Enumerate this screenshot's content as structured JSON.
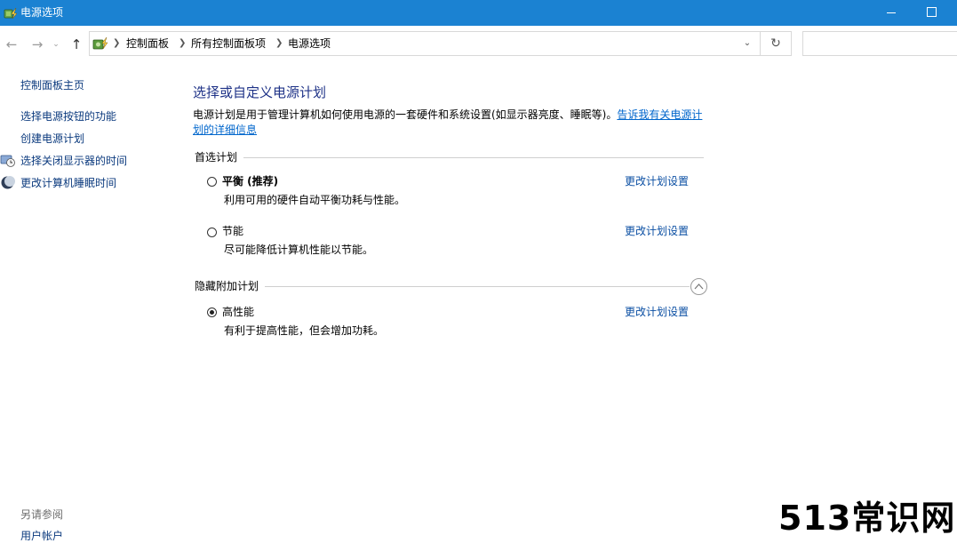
{
  "window": {
    "title": "电源选项",
    "icons": {
      "app": "power-options-icon",
      "minimize": "minimize-icon",
      "maximize": "maximize-icon"
    },
    "accent": "#1b82d2"
  },
  "nav": {
    "back_icon": "←",
    "forward_icon": "→",
    "recent_icon": "⌄",
    "up_icon": "↑",
    "breadcrumb": [
      "控制面板",
      "所有控制面板项",
      "电源选项"
    ],
    "dropdown_icon": "⌄",
    "refresh_icon": "↻",
    "search_placeholder": ""
  },
  "sidebar": {
    "home": "控制面板主页",
    "links": [
      {
        "label": "选择电源按钮的功能",
        "icon": null
      },
      {
        "label": "创建电源计划",
        "icon": null
      },
      {
        "label": "选择关闭显示器的时间",
        "icon": "monitor-clock-icon"
      },
      {
        "label": "更改计算机睡眠时间",
        "icon": "moon-icon"
      }
    ],
    "see_also": "另请参阅",
    "see_also_links": [
      "用户帐户"
    ]
  },
  "main": {
    "title": "选择或自定义电源计划",
    "description": "电源计划是用于管理计算机如何使用电源的一套硬件和系统设置(如显示器亮度、睡眠等)。",
    "description_link": "告诉我有关电源计划的详细信息",
    "preferred_header": "首选计划",
    "hidden_header": "隐藏附加计划",
    "plans": [
      {
        "name": "平衡 (推荐)",
        "desc": "利用可用的硬件自动平衡功耗与性能。",
        "checked": false,
        "link": "更改计划设置"
      },
      {
        "name": "节能",
        "desc": "尽可能降低计算机性能以节能。",
        "checked": false,
        "link": "更改计划设置"
      },
      {
        "name": "高性能",
        "desc": "有利于提高性能，但会增加功耗。",
        "checked": true,
        "link": "更改计划设置"
      }
    ]
  },
  "watermark": "513常识网"
}
